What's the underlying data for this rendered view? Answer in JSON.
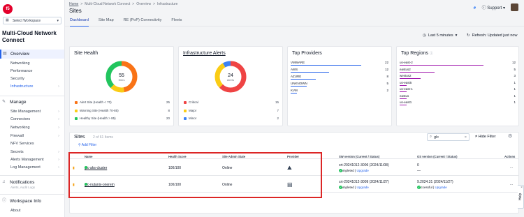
{
  "workspace": {
    "select_label": "Select Workspace"
  },
  "app": {
    "name": "Multi-Cloud Network Connect"
  },
  "sidebar": {
    "overview": "Overview",
    "overview_items": [
      "Networking",
      "Performance",
      "Security",
      "Infrastructure"
    ],
    "manage": "Manage",
    "manage_items": [
      "Site Management",
      "Connectors",
      "Networking",
      "Firewall",
      "NFV Services",
      "Secrets",
      "Alerts Management",
      "Log Management"
    ],
    "notifications": "Notifications",
    "notifications_sub": "Alerts, Audit Logs",
    "workspace_info": "Workspace Info",
    "about": "About"
  },
  "breadcrumb": {
    "home": "Home",
    "sep": ">",
    "app": "Multi-Cloud Network Connect",
    "overview": "Overview",
    "current": "Infrastructure"
  },
  "page": {
    "title": "Sites"
  },
  "header": {
    "support": "Support"
  },
  "tabs": [
    "Dashboard",
    "Site Map",
    "RE (PoP) Connectivity",
    "Fleets"
  ],
  "toolbar": {
    "time_range": "Last 5 minutes",
    "refresh": "Refresh: Updated just now"
  },
  "site_health": {
    "title": "Site Health",
    "total": "55",
    "total_label": "Sites",
    "legend": [
      {
        "label": "Alert Site (Health < 70)",
        "value": "25",
        "color": "#f97316"
      },
      {
        "label": "Warning Site (Health 70-85)",
        "value": "8",
        "color": "#facc15"
      },
      {
        "label": "Healthy Site (Health > 85)",
        "value": "20",
        "color": "#22c55e"
      }
    ]
  },
  "infra_alerts": {
    "title": "Infrastructure Alerts",
    "total": "24",
    "total_label": "Alerts",
    "legend": [
      {
        "label": "Critical",
        "value": "15",
        "color": "#ef4444"
      },
      {
        "label": "Major",
        "value": "7",
        "color": "#facc15"
      },
      {
        "label": "Minor",
        "value": "2",
        "color": "#3b82f6"
      }
    ]
  },
  "top_providers": {
    "title": "Top Providers",
    "items": [
      {
        "label": "VMWARE",
        "value": "22",
        "fraction": 1.0
      },
      {
        "label": "AWS",
        "value": "12",
        "fraction": 0.55
      },
      {
        "label": "AZURE",
        "value": "8",
        "fraction": 0.36
      },
      {
        "label": "UNKNOWN",
        "value": "5",
        "fraction": 0.23
      },
      {
        "label": "KVM",
        "value": "2",
        "fraction": 0.09
      }
    ]
  },
  "top_regions": {
    "title": "Top Regions",
    "items": [
      {
        "label": "us-east-2",
        "value": "12",
        "fraction": 1.0
      },
      {
        "label": "eastus2",
        "value": "5",
        "fraction": 0.42
      },
      {
        "label": "westus2",
        "value": "3",
        "fraction": 0.25
      },
      {
        "label": "us-east5",
        "value": "1",
        "fraction": 0.08
      },
      {
        "label": "us-east-1",
        "value": "1",
        "fraction": 0.08
      },
      {
        "label": "eastus",
        "value": "1",
        "fraction": 0.08
      },
      {
        "label": "us-east1",
        "value": "1",
        "fraction": 0.08
      }
    ]
  },
  "sites": {
    "title": "Sites",
    "count": "2 of 61 Items",
    "add_filter": "Add Filter",
    "search_value": "glc",
    "hide_filter": "Hide Filter",
    "columns": [
      "Name",
      "Health Score",
      "Site Admin State",
      "Provider",
      "SW version (Current / Status)",
      "OS version (Current / Status)",
      "Actions"
    ],
    "rows": [
      {
        "name": "glc-aks-cluster",
        "health": "100",
        "health_unit": "/100",
        "state": "Online",
        "sw_version": "crt-20241012-3006 (2024/11/08)",
        "sw_status": "Completed",
        "sw_action": "Upgrade",
        "os_version": "0",
        "os_status": "—",
        "os_action": ""
      },
      {
        "name": "glc-nutanix-onerem",
        "health": "100",
        "health_unit": "/100",
        "state": "Online",
        "sw_version": "crt-20241012-3009 (2024/11/27)",
        "sw_status": "Completed",
        "sw_action": "Upgrade",
        "os_version": "9.2024.31 (2024/11/27)",
        "os_status": "Successful",
        "os_action": "Upgrade"
      }
    ],
    "actions_label": "..."
  },
  "help": {
    "label": "Help"
  },
  "colors": {
    "accent": "#2563eb",
    "brand": "#e4002b",
    "highlight": "#dc2626"
  }
}
